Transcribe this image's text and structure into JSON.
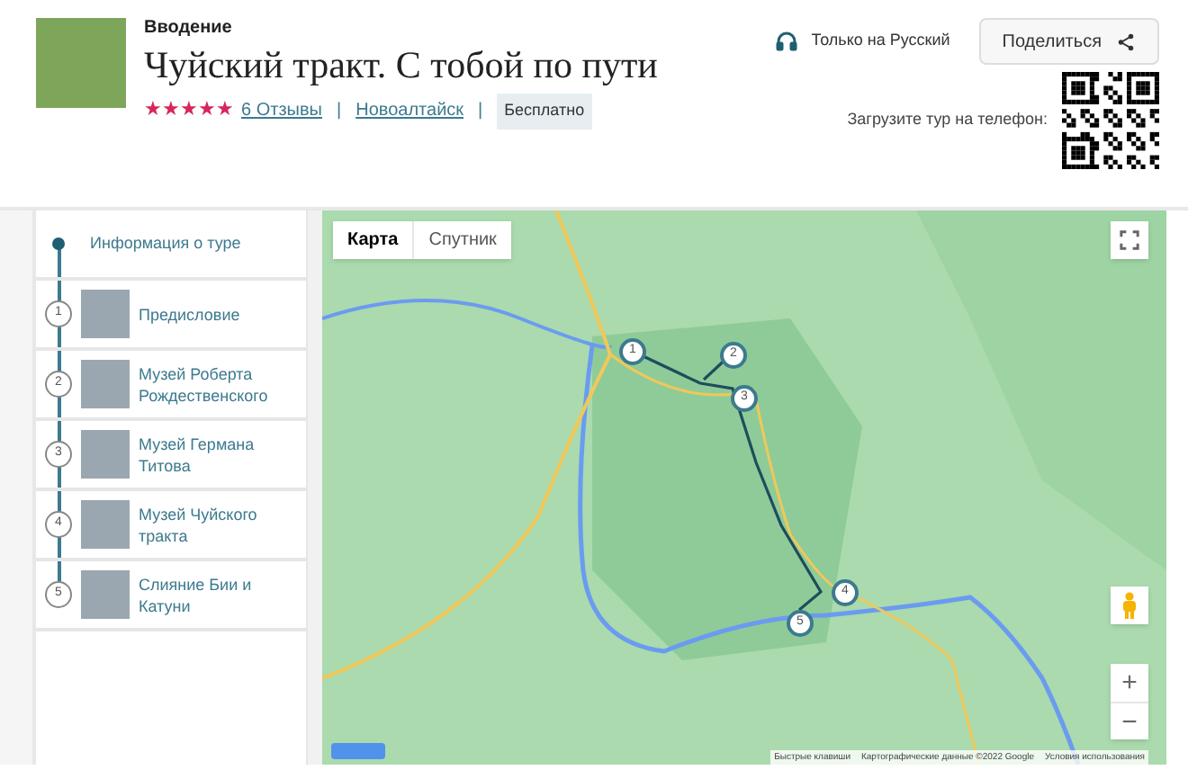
{
  "header": {
    "section": "Вводение",
    "title": "Чуйский тракт. С тобой по пути",
    "stars": 5,
    "reviews": "6 Отзывы",
    "separator_1": "|",
    "city": "Новоалтайск",
    "separator_2": "|",
    "price_tag": "Бесплатно",
    "language": "Только на Русский",
    "share_button": "Поделиться",
    "qr_caption": "Загрузите тур на телефон:"
  },
  "stops": [
    {
      "title": "Информация о туре",
      "kind": "info"
    },
    {
      "marker": "1",
      "title": "Предисловие",
      "kind": "stop"
    },
    {
      "marker": "2",
      "title": "Музей Роберта Рождественского",
      "kind": "stop"
    },
    {
      "marker": "3",
      "title": "Музей Германа Титова",
      "kind": "stop"
    },
    {
      "marker": "4",
      "title": "Музей Чуйского тракта",
      "kind": "stop"
    },
    {
      "marker": "5",
      "title": "Слияние Бии и Катуни",
      "kind": "stop"
    }
  ],
  "map": {
    "tabs": [
      {
        "label": "Карта",
        "selected": true
      },
      {
        "label": "Спутник",
        "selected": false
      }
    ],
    "markers": [
      "1",
      "2",
      "3",
      "4",
      "5"
    ],
    "zoom_in": "+",
    "zoom_out": "−",
    "attribution": [
      "Быстрые клавиши",
      "Картографические данные ©2022 Google",
      "Условия использования"
    ]
  }
}
